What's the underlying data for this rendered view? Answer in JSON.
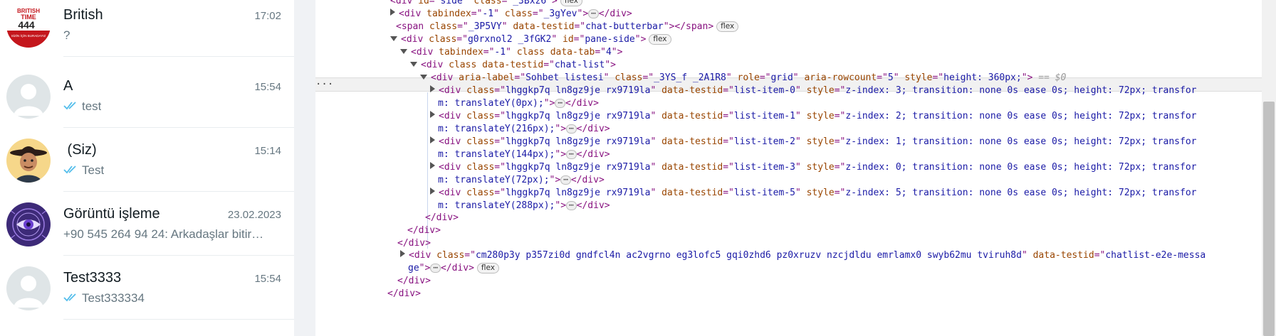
{
  "chats": [
    {
      "name": "British",
      "time": "17:02",
      "preview": "?",
      "read_ticks": false,
      "avatar": "british-time-logo-avatar",
      "logo_text": [
        "BRITISH",
        "TIME",
        "444",
        "SİZİN İÇİN BURADAYIZ"
      ]
    },
    {
      "name": "A",
      "time": "15:54",
      "preview": "test",
      "read_ticks": true,
      "avatar": "default-avatar"
    },
    {
      "name": " (Siz)",
      "time": "15:14",
      "preview": "Test",
      "read_ticks": true,
      "avatar": "cowboy-avatar"
    },
    {
      "name": "Görüntü işleme",
      "time": "23.02.2023",
      "preview": "+90 545 264 94 24: Arkadaşlar  bitir…",
      "read_ticks": false,
      "avatar": "eye-circuit-avatar"
    },
    {
      "name": "Test3333",
      "time": "15:54",
      "preview": "Test333334",
      "read_ticks": true,
      "avatar": "default-avatar"
    }
  ],
  "colors": {
    "tick_blue": "#53bdeb",
    "tag": "#881280",
    "attr_name": "#994500",
    "attr_value": "#1a1aa6"
  },
  "devtools": {
    "row_dots": "···",
    "lines": [
      {
        "arrow": "none",
        "parts": [
          [
            "t",
            "<div "
          ],
          [
            "an",
            "id"
          ],
          [
            "t",
            "=\""
          ],
          [
            "av",
            "side"
          ],
          [
            "t",
            "\" "
          ],
          [
            "an",
            "class"
          ],
          [
            "t",
            "=\""
          ],
          [
            "av",
            "_3Bxz6"
          ],
          [
            "t",
            "\">"
          ]
        ],
        "badge": "flex"
      },
      {
        "arrow": "collapsed",
        "parts": [
          [
            "t",
            "<div "
          ],
          [
            "an",
            "tabindex"
          ],
          [
            "t",
            "=\""
          ],
          [
            "av",
            "-1"
          ],
          [
            "t",
            "\" "
          ],
          [
            "an",
            "class"
          ],
          [
            "t",
            "=\""
          ],
          [
            "av",
            "_3gYev"
          ],
          [
            "t",
            "\">"
          ]
        ],
        "ellipsis": true,
        "tail": "</div>"
      },
      {
        "arrow": "none",
        "parts": [
          [
            "t",
            "<span "
          ],
          [
            "an",
            "class"
          ],
          [
            "t",
            "=\""
          ],
          [
            "av",
            "_3P5VY"
          ],
          [
            "t",
            "\" "
          ],
          [
            "an",
            "data-testid"
          ],
          [
            "t",
            "=\""
          ],
          [
            "av",
            "chat-butterbar"
          ],
          [
            "t",
            "\"></span>"
          ]
        ],
        "badge": "flex"
      },
      {
        "arrow": "expanded",
        "parts": [
          [
            "t",
            "<div "
          ],
          [
            "an",
            "class"
          ],
          [
            "t",
            "=\""
          ],
          [
            "av",
            "g0rxnol2 _3fGK2"
          ],
          [
            "t",
            "\" "
          ],
          [
            "an",
            "id"
          ],
          [
            "t",
            "=\""
          ],
          [
            "av",
            "pane-side"
          ],
          [
            "t",
            "\">"
          ]
        ],
        "badge": "flex"
      },
      {
        "arrow": "expanded",
        "parts": [
          [
            "t",
            "<div "
          ],
          [
            "an",
            "tabindex"
          ],
          [
            "t",
            "=\""
          ],
          [
            "av",
            "-1"
          ],
          [
            "t",
            "\" "
          ],
          [
            "an",
            "class data-tab"
          ],
          [
            "t",
            "=\""
          ],
          [
            "av",
            "4"
          ],
          [
            "t",
            "\">"
          ]
        ]
      },
      {
        "arrow": "expanded",
        "parts": [
          [
            "t",
            "<div "
          ],
          [
            "an",
            "class data-testid"
          ],
          [
            "t",
            "=\""
          ],
          [
            "av",
            "chat-list"
          ],
          [
            "t",
            "\">"
          ]
        ]
      },
      {
        "arrow": "expanded",
        "parts": [
          [
            "t",
            "<div "
          ],
          [
            "an",
            "aria-label"
          ],
          [
            "t",
            "=\""
          ],
          [
            "av",
            "Sohbet listesi"
          ],
          [
            "t",
            "\" "
          ],
          [
            "an",
            "class"
          ],
          [
            "t",
            "=\""
          ],
          [
            "av",
            "_3YS_f _2A1R8"
          ],
          [
            "t",
            "\" "
          ],
          [
            "an",
            "role"
          ],
          [
            "t",
            "=\""
          ],
          [
            "av",
            "grid"
          ],
          [
            "t",
            "\" "
          ],
          [
            "an",
            "aria-rowcount"
          ],
          [
            "t",
            "=\""
          ],
          [
            "av",
            "5"
          ],
          [
            "t",
            "\" "
          ],
          [
            "an",
            "style"
          ],
          [
            "t",
            "=\""
          ],
          [
            "av",
            "height: 360px;"
          ],
          [
            "t",
            "\">"
          ]
        ],
        "eq": " == $0"
      },
      {
        "arrow": "collapsed",
        "parts": [
          [
            "t",
            "<div "
          ],
          [
            "an",
            "class"
          ],
          [
            "t",
            "=\""
          ],
          [
            "av",
            "lhggkp7q ln8gz9je rx9719la"
          ],
          [
            "t",
            "\" "
          ],
          [
            "an",
            "data-testid"
          ],
          [
            "t",
            "=\""
          ],
          [
            "av",
            "list-item-0"
          ],
          [
            "t",
            "\" "
          ],
          [
            "an",
            "style"
          ],
          [
            "t",
            "=\""
          ],
          [
            "av",
            "z-index: 3; transition: none 0s ease 0s; height: 72px; transfor"
          ]
        ]
      },
      {
        "arrow": "none",
        "parts": [
          [
            "av",
            "m: translateY(0px);"
          ],
          [
            "t",
            "\">"
          ]
        ],
        "ellipsis": true,
        "tail": "</div>"
      },
      {
        "arrow": "collapsed",
        "parts": [
          [
            "t",
            "<div "
          ],
          [
            "an",
            "class"
          ],
          [
            "t",
            "=\""
          ],
          [
            "av",
            "lhggkp7q ln8gz9je rx9719la"
          ],
          [
            "t",
            "\" "
          ],
          [
            "an",
            "data-testid"
          ],
          [
            "t",
            "=\""
          ],
          [
            "av",
            "list-item-1"
          ],
          [
            "t",
            "\" "
          ],
          [
            "an",
            "style"
          ],
          [
            "t",
            "=\""
          ],
          [
            "av",
            "z-index: 2; transition: none 0s ease 0s; height: 72px; transfor"
          ]
        ]
      },
      {
        "arrow": "none",
        "parts": [
          [
            "av",
            "m: translateY(216px);"
          ],
          [
            "t",
            "\">"
          ]
        ],
        "ellipsis": true,
        "tail": "</div>"
      },
      {
        "arrow": "collapsed",
        "parts": [
          [
            "t",
            "<div "
          ],
          [
            "an",
            "class"
          ],
          [
            "t",
            "=\""
          ],
          [
            "av",
            "lhggkp7q ln8gz9je rx9719la"
          ],
          [
            "t",
            "\" "
          ],
          [
            "an",
            "data-testid"
          ],
          [
            "t",
            "=\""
          ],
          [
            "av",
            "list-item-2"
          ],
          [
            "t",
            "\" "
          ],
          [
            "an",
            "style"
          ],
          [
            "t",
            "=\""
          ],
          [
            "av",
            "z-index: 1; transition: none 0s ease 0s; height: 72px; transfor"
          ]
        ]
      },
      {
        "arrow": "none",
        "parts": [
          [
            "av",
            "m: translateY(144px);"
          ],
          [
            "t",
            "\">"
          ]
        ],
        "ellipsis": true,
        "tail": "</div>"
      },
      {
        "arrow": "collapsed",
        "parts": [
          [
            "t",
            "<div "
          ],
          [
            "an",
            "class"
          ],
          [
            "t",
            "=\""
          ],
          [
            "av",
            "lhggkp7q ln8gz9je rx9719la"
          ],
          [
            "t",
            "\" "
          ],
          [
            "an",
            "data-testid"
          ],
          [
            "t",
            "=\""
          ],
          [
            "av",
            "list-item-3"
          ],
          [
            "t",
            "\" "
          ],
          [
            "an",
            "style"
          ],
          [
            "t",
            "=\""
          ],
          [
            "av",
            "z-index: 0; transition: none 0s ease 0s; height: 72px; transfor"
          ]
        ]
      },
      {
        "arrow": "none",
        "parts": [
          [
            "av",
            "m: translateY(72px);"
          ],
          [
            "t",
            "\">"
          ]
        ],
        "ellipsis": true,
        "tail": "</div>"
      },
      {
        "arrow": "collapsed",
        "parts": [
          [
            "t",
            "<div "
          ],
          [
            "an",
            "class"
          ],
          [
            "t",
            "=\""
          ],
          [
            "av",
            "lhggkp7q ln8gz9je rx9719la"
          ],
          [
            "t",
            "\" "
          ],
          [
            "an",
            "data-testid"
          ],
          [
            "t",
            "=\""
          ],
          [
            "av",
            "list-item-5"
          ],
          [
            "t",
            "\" "
          ],
          [
            "an",
            "style"
          ],
          [
            "t",
            "=\""
          ],
          [
            "av",
            "z-index: 5; transition: none 0s ease 0s; height: 72px; transfor"
          ]
        ]
      },
      {
        "arrow": "none",
        "parts": [
          [
            "av",
            "m: translateY(288px);"
          ],
          [
            "t",
            "\">"
          ]
        ],
        "ellipsis": true,
        "tail": "</div>"
      },
      {
        "arrow": "none",
        "parts": [
          [
            "t",
            "</div>"
          ]
        ]
      },
      {
        "arrow": "none",
        "parts": [
          [
            "t",
            "</div>"
          ]
        ]
      },
      {
        "arrow": "none",
        "parts": [
          [
            "t",
            "</div>"
          ]
        ]
      },
      {
        "arrow": "collapsed",
        "parts": [
          [
            "t",
            "<div "
          ],
          [
            "an",
            "class"
          ],
          [
            "t",
            "=\""
          ],
          [
            "av",
            "cm280p3y p357zi0d gndfcl4n ac2vgrno eg3lofc5 gqi0zhd6 pz0xruzv nzcjdldu emrlamx0 swyb62mu tviruh8d"
          ],
          [
            "t",
            "\" "
          ],
          [
            "an",
            "data-testid"
          ],
          [
            "t",
            "=\""
          ],
          [
            "av",
            "chatlist-e2e-messa"
          ]
        ]
      },
      {
        "arrow": "none",
        "parts": [
          [
            "av",
            "ge"
          ],
          [
            "t",
            "\">"
          ]
        ],
        "ellipsis": true,
        "tail": "</div>",
        "badge": "flex"
      },
      {
        "arrow": "none",
        "parts": [
          [
            "t",
            "</div>"
          ]
        ]
      },
      {
        "arrow": "none",
        "parts": [
          [
            "t",
            "</div>"
          ]
        ]
      }
    ]
  }
}
